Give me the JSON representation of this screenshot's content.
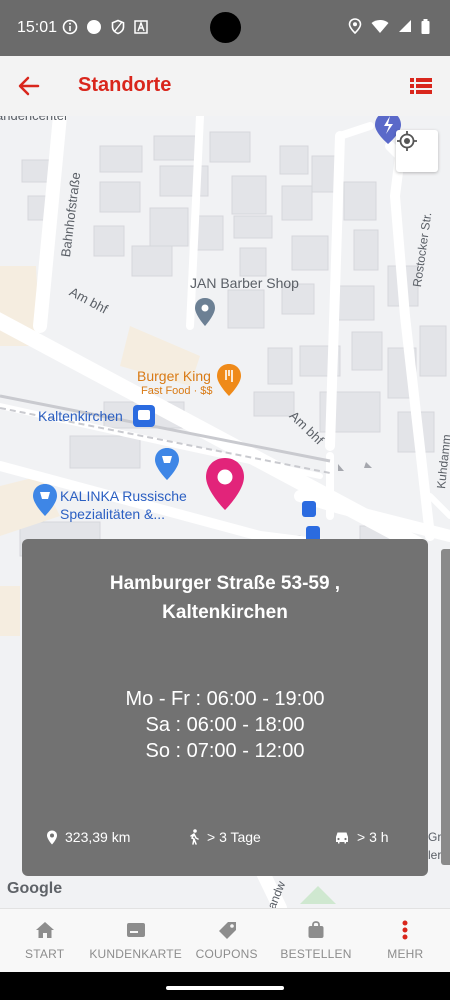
{
  "status_bar": {
    "time": "15:01"
  },
  "app_bar": {
    "title": "Standorte"
  },
  "map": {
    "labels": {
      "center_cut": "andencenter",
      "bahnhofstrasse": "Bahnhofstraße",
      "rostocker": "Rostocker Str.",
      "am_bhf_1": "Am bhf",
      "am_bhf_2": "Am bhf",
      "jan_barber": "JAN Barber Shop",
      "burger_king": "Burger King",
      "burger_king_sub": "Fast Food · $$",
      "kaltenkirchen": "Kaltenkirchen",
      "kalinka_1": "KALINKA Russische",
      "kalinka_2": "Spezialitäten &...",
      "kuhdamm": "Kuhdamm",
      "landweg": "Landw",
      "gru_1": "Gru",
      "gru_2": "ler",
      "google": "Google"
    }
  },
  "store": {
    "address_line1": "Hamburger Straße 53-59 ,",
    "address_line2": "Kaltenkirchen",
    "hours": [
      "Mo - Fr : 06:00 - 19:00",
      "Sa : 06:00 - 18:00",
      "So : 07:00 - 12:00"
    ],
    "distance": "323,39 km",
    "walk_time": "> 3 Tage",
    "drive_time": "> 3 h"
  },
  "bottom_nav": [
    {
      "label": "START",
      "icon": "home-icon"
    },
    {
      "label": "KUNDENKARTE",
      "icon": "card-icon"
    },
    {
      "label": "COUPONS",
      "icon": "tag-icon"
    },
    {
      "label": "BESTELLEN",
      "icon": "bag-icon"
    },
    {
      "label": "MEHR",
      "icon": "more-vertical-icon"
    }
  ],
  "colors": {
    "brand_red": "#d9261c",
    "pin_pink": "#e2247a",
    "card_grey": "#727272"
  }
}
